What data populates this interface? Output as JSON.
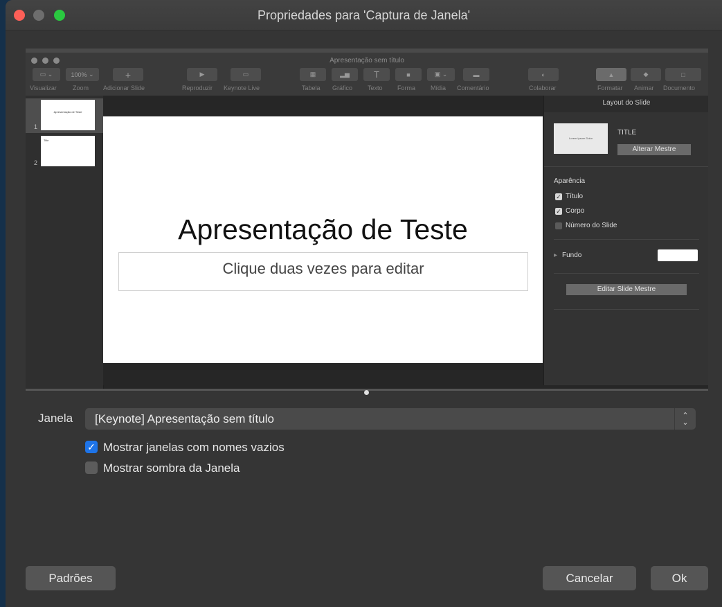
{
  "dialog": {
    "title": "Propriedades para 'Captura de Janela'",
    "window_label": "Janela",
    "window_value": "[Keynote] Apresentação sem título",
    "show_empty_names": {
      "label": "Mostrar janelas com nomes vazios",
      "checked": true
    },
    "show_shadow": {
      "label": "Mostrar sombra da Janela",
      "checked": false
    },
    "defaults_button": "Padrões",
    "cancel_button": "Cancelar",
    "ok_button": "Ok"
  },
  "keynote": {
    "window_title": "Apresentação sem título",
    "zoom": "100%",
    "toolbar_labels": {
      "view": "Visualizar",
      "zoom": "Zoom",
      "add_slide": "Adicionar Slide",
      "play": "Reproduzir",
      "keynote_live": "Keynote Live",
      "table": "Tabela",
      "chart": "Gráfico",
      "text": "Texto",
      "shape": "Forma",
      "media": "Mídia",
      "comment": "Comentário",
      "collaborate": "Colaborar",
      "format": "Formatar",
      "animate": "Animar",
      "document": "Documento"
    },
    "slides": [
      {
        "number": "1",
        "thumb_text": "Apresentação de Teste"
      },
      {
        "number": "2",
        "thumb_text": "Title"
      }
    ],
    "slide": {
      "title": "Apresentação de Teste",
      "body_placeholder": "Clique duas vezes para editar"
    },
    "inspector": {
      "header": "Layout do Slide",
      "thumb_text": "Lorem Ipsum Dolor",
      "master_name": "TITLE",
      "change_master": "Alterar Mestre",
      "appearance": "Aparência",
      "title_check": "Título",
      "body_check": "Corpo",
      "slide_number_check": "Número do Slide",
      "background": "Fundo",
      "edit_master": "Editar Slide Mestre"
    }
  },
  "colors": {
    "accent": "#1e74e8",
    "close": "#fd5f57",
    "zoom": "#2ac940"
  }
}
